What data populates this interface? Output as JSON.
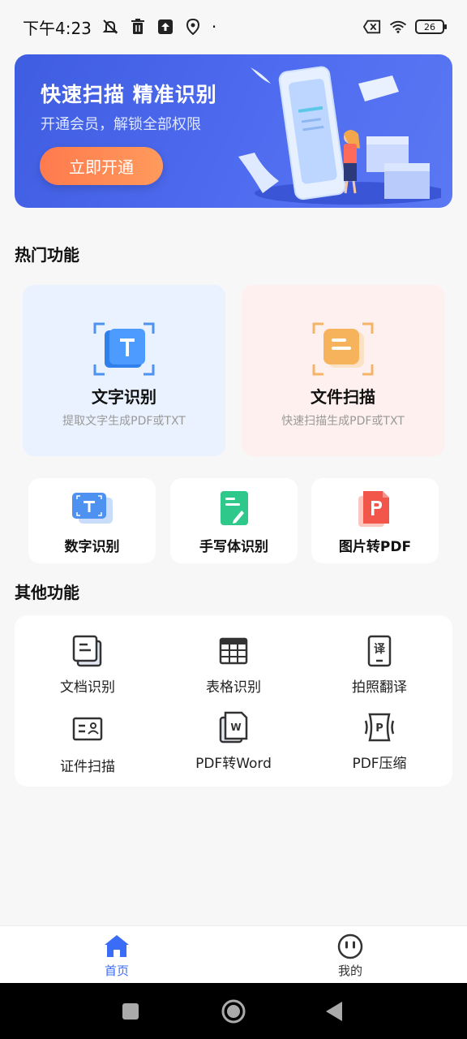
{
  "status_bar": {
    "time": "下午4:23",
    "dot": "·",
    "battery": "26"
  },
  "banner": {
    "title": "快速扫描  精准识别",
    "subtitle": "开通会员，解锁全部权限",
    "button_label": "立即开通"
  },
  "hot_section": {
    "title": "热门功能",
    "cards": [
      {
        "title": "文字识别",
        "subtitle": "提取文字生成PDF或TXT",
        "icon": "text-recognition-icon",
        "bg": "#e9f2fe"
      },
      {
        "title": "文件扫描",
        "subtitle": "快速扫描生成PDF或TXT",
        "icon": "file-scan-icon",
        "bg": "#fef0ee"
      }
    ],
    "mini_cards": [
      {
        "label": "数字识别",
        "icon": "number-recognition-icon"
      },
      {
        "label": "手写体识别",
        "icon": "handwriting-recognition-icon"
      },
      {
        "label": "图片转PDF",
        "icon": "image-to-pdf-icon"
      }
    ]
  },
  "other_section": {
    "title": "其他功能",
    "items": [
      {
        "label": "文档识别",
        "icon": "document-recognition-icon"
      },
      {
        "label": "表格识别",
        "icon": "table-recognition-icon"
      },
      {
        "label": "拍照翻译",
        "icon": "photo-translate-icon"
      },
      {
        "label": "证件扫描",
        "icon": "id-card-scan-icon"
      },
      {
        "label": "PDF转Word",
        "icon": "pdf-to-word-icon"
      },
      {
        "label": "PDF压缩",
        "icon": "pdf-compress-icon"
      }
    ]
  },
  "bottom_nav": {
    "items": [
      {
        "label": "首页",
        "icon": "home-icon",
        "active": true
      },
      {
        "label": "我的",
        "icon": "profile-icon",
        "active": false
      }
    ]
  },
  "colors": {
    "accent": "#3b6cf5",
    "banner": "#4a66ec",
    "cta": "#ff7f50"
  }
}
